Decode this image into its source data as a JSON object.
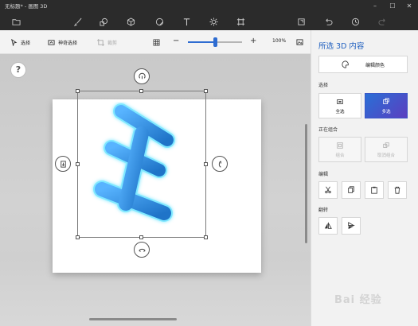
{
  "window": {
    "title": "无标题* - 画图 3D",
    "controls": [
      "minimize-icon",
      "maximize-icon",
      "close-icon"
    ]
  },
  "toolbar": {
    "tools": [
      "folder-icon",
      "brush-icon",
      "2d-shapes-icon",
      "3d-shapes-icon",
      "stickers-icon",
      "text-icon",
      "effects-icon",
      "canvas-icon",
      "mixed-reality-icon",
      "undo-icon",
      "history-icon",
      "redo-icon"
    ]
  },
  "command_bar": {
    "select_label": "选择",
    "magic_select_label": "神奇选择",
    "crop_label": "裁剪",
    "zoom_percent": "100%",
    "zoom_level": 0.5
  },
  "canvas": {
    "help_label": "?"
  },
  "panel": {
    "title": "所选 3D 内容",
    "edit_color_label": "编辑颜色",
    "select_section": "选择",
    "select_all_label": "全选",
    "multi_select_label": "多选",
    "group_section": "正在组合",
    "group_label": "组合",
    "ungroup_label": "取消组合",
    "edit_section": "编辑",
    "flip_section": "翻转",
    "accent_color": "#2a6fd6"
  },
  "watermark": "Bai 经验"
}
